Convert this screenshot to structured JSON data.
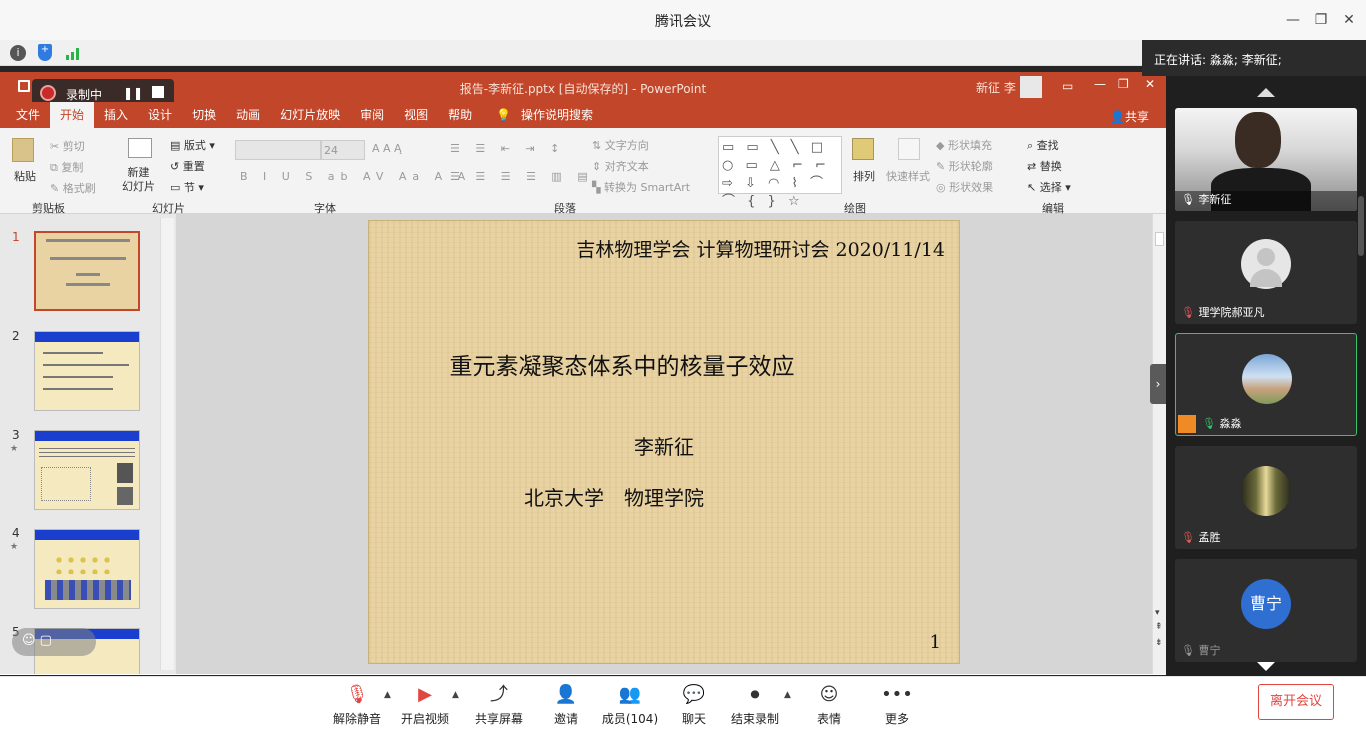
{
  "window": {
    "title": "腾讯会议"
  },
  "recording": {
    "label": "录制中"
  },
  "speaking": {
    "text": "正在讲话: 淼淼; 李新征;"
  },
  "ppt": {
    "title": "报告-李新征.pptx [自动保存的]  -  PowerPoint",
    "user": "新征 李",
    "share_label": "共享",
    "tabs": [
      "文件",
      "开始",
      "插入",
      "设计",
      "切换",
      "动画",
      "幻灯片放映",
      "审阅",
      "视图",
      "帮助"
    ],
    "search_label": "操作说明搜索",
    "ribbon": {
      "clipboard": {
        "paste": "粘贴",
        "cut": "剪切",
        "copy": "复制",
        "format_painter": "格式刷",
        "group": "剪贴板"
      },
      "slides": {
        "new_slide": "新建\n幻灯片",
        "layout": "版式",
        "reset": "重置",
        "section": "节",
        "group": "幻灯片"
      },
      "font": {
        "size": "24",
        "group": "字体"
      },
      "paragraph": {
        "text_direction": "文字方向",
        "align_text": "对齐文本",
        "smartart": "转换为 SmartArt",
        "group": "段落"
      },
      "drawing": {
        "arrange": "排列",
        "quick_styles": "快速样式",
        "shape_fill": "形状填充",
        "shape_outline": "形状轮廓",
        "shape_effects": "形状效果",
        "group": "绘图"
      },
      "editing": {
        "find": "查找",
        "replace": "替换",
        "select": "选择",
        "group": "编辑"
      }
    },
    "slide_numbers": [
      "1",
      "2",
      "3",
      "4",
      "5"
    ],
    "slide": {
      "header": "吉林物理学会 计算物理研讨会 2020/11/14",
      "title": "重元素凝聚态体系中的核量子效应",
      "author": "李新征",
      "affiliation": "北京大学　物理学院",
      "page": "1"
    }
  },
  "participants": [
    {
      "name": "李新征"
    },
    {
      "name": "理学院郝亚凡"
    },
    {
      "name": "淼淼"
    },
    {
      "name": "孟胜"
    },
    {
      "name": "曹宁",
      "avatar_text": "曹宁"
    }
  ],
  "toolbar": {
    "unmute": "解除静音",
    "video": "开启视频",
    "share": "共享屏幕",
    "invite": "邀请",
    "members": "成员(104)",
    "chat": "聊天",
    "end_record": "结束录制",
    "emoji": "表情",
    "more": "更多",
    "leave": "离开会议"
  },
  "colors": {
    "ppt_accent": "#c1462a",
    "leave_red": "#e0463f",
    "active_green": "#35c46a",
    "avatar_blue": "#2f6fd1"
  }
}
